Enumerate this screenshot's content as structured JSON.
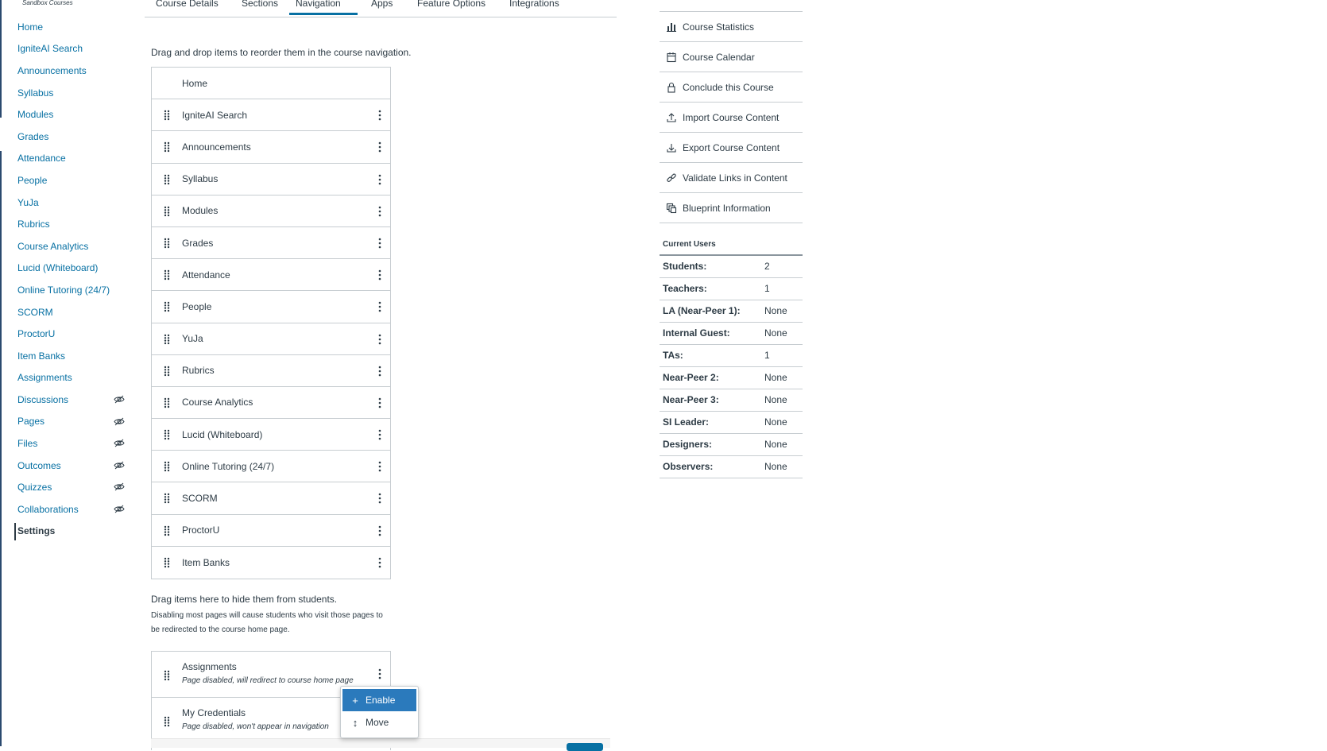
{
  "brand": {
    "subtitle": "Sandbox Courses"
  },
  "course_nav": {
    "items": [
      {
        "label": "Home",
        "hidden": false
      },
      {
        "label": "IgniteAI Search",
        "hidden": false
      },
      {
        "label": "Announcements",
        "hidden": false
      },
      {
        "label": "Syllabus",
        "hidden": false
      },
      {
        "label": "Modules",
        "hidden": false
      },
      {
        "label": "Grades",
        "hidden": false
      },
      {
        "label": "Attendance",
        "hidden": false
      },
      {
        "label": "People",
        "hidden": false
      },
      {
        "label": "YuJa",
        "hidden": false
      },
      {
        "label": "Rubrics",
        "hidden": false
      },
      {
        "label": "Course Analytics",
        "hidden": false
      },
      {
        "label": "Lucid (Whiteboard)",
        "hidden": false
      },
      {
        "label": "Online Tutoring (24/7)",
        "hidden": false
      },
      {
        "label": "SCORM",
        "hidden": false
      },
      {
        "label": "ProctorU",
        "hidden": false
      },
      {
        "label": "Item Banks",
        "hidden": false
      },
      {
        "label": "Assignments",
        "hidden": false
      },
      {
        "label": "Discussions",
        "hidden": true
      },
      {
        "label": "Pages",
        "hidden": true
      },
      {
        "label": "Files",
        "hidden": true
      },
      {
        "label": "Outcomes",
        "hidden": true
      },
      {
        "label": "Quizzes",
        "hidden": true
      },
      {
        "label": "Collaborations",
        "hidden": true
      },
      {
        "label": "Settings",
        "hidden": false,
        "active": true
      }
    ]
  },
  "tabs": {
    "course_details": "Course Details",
    "sections": "Sections",
    "navigation": "Navigation",
    "apps": "Apps",
    "feature_options": "Feature Options",
    "integrations": "Integrations",
    "active": "Navigation"
  },
  "navigation_panel": {
    "instruction": "Drag and drop items to reorder them in the course navigation.",
    "home_label": "Home",
    "enabled_items": [
      "IgniteAI Search",
      "Announcements",
      "Syllabus",
      "Modules",
      "Grades",
      "Attendance",
      "People",
      "YuJa",
      "Rubrics",
      "Course Analytics",
      "Lucid (Whiteboard)",
      "Online Tutoring (24/7)",
      "SCORM",
      "ProctorU",
      "Item Banks"
    ],
    "hide_instruction": "Drag items here to hide them from students.",
    "hide_note": "Disabling most pages will cause students who visit those pages to be redirected to the course home page.",
    "disabled_items": [
      {
        "label": "Assignments",
        "note": "Page disabled, will redirect to course home page"
      },
      {
        "label": "My Credentials",
        "note": "Page disabled, won't appear in navigation"
      }
    ],
    "context_menu": {
      "enable": "Enable",
      "move": "Move"
    }
  },
  "sidebar_links": {
    "course_statistics": "Course Statistics",
    "course_calendar": "Course Calendar",
    "conclude_course": "Conclude this Course",
    "import_content": "Import Course Content",
    "export_content": "Export Course Content",
    "validate_links": "Validate Links in Content",
    "blueprint_info": "Blueprint Information"
  },
  "current_users": {
    "title": "Current Users",
    "rows": [
      {
        "role": "Students:",
        "count": "2"
      },
      {
        "role": "Teachers:",
        "count": "1"
      },
      {
        "role": "LA (Near-Peer 1):",
        "count": "None"
      },
      {
        "role": "Internal Guest:",
        "count": "None"
      },
      {
        "role": "TAs:",
        "count": "1"
      },
      {
        "role": "Near-Peer 2:",
        "count": "None"
      },
      {
        "role": "Near-Peer 3:",
        "count": "None"
      },
      {
        "role": "SI Leader:",
        "count": "None"
      },
      {
        "role": "Designers:",
        "count": "None"
      },
      {
        "role": "Observers:",
        "count": "None"
      }
    ]
  },
  "colors": {
    "link": "#0770a3",
    "text": "#2d3b45",
    "menu_highlight": "#2b7abc",
    "border": "#c7cdd1"
  }
}
